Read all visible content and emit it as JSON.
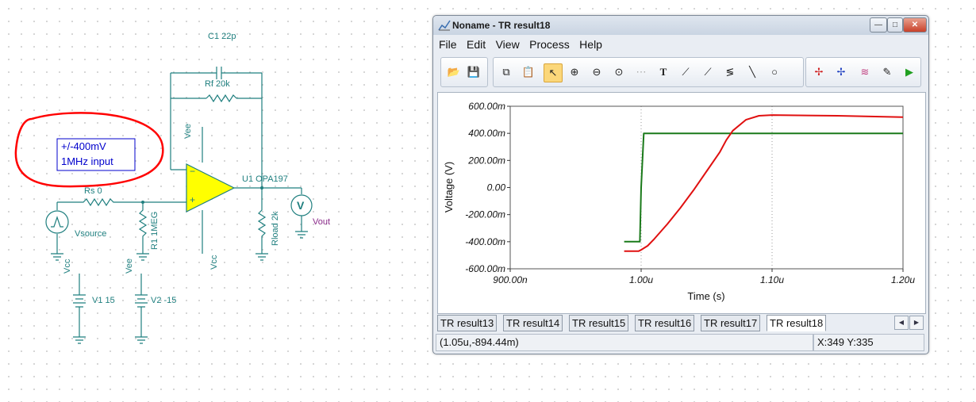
{
  "schematic": {
    "labels": {
      "c1": "C1 22p",
      "rf": "Rf 20k",
      "vee_opamp": "Vee",
      "u1": "U1 OPA197",
      "rs": "Rs 0",
      "r1": "R1 1MEG",
      "vsource": "Vsource",
      "vcc_opamp": "Vcc",
      "rload": "Rload 2k",
      "vout": "Vout",
      "vcc_supply": "Vcc",
      "vee_supply": "Vee",
      "v1": "V1 15",
      "v2": "V2 -15",
      "meter": "V"
    },
    "annotation": {
      "line1": "+/-400mV",
      "line2": "1MHz input"
    },
    "colors": {
      "wire": "#1f7f7f",
      "opamp_fill": "#ffff00",
      "annotation_circle": "#ff0000",
      "annotation_text": "#0000cc",
      "vout_label": "#8a2a8a"
    }
  },
  "window": {
    "title": "Noname - TR result18",
    "buttons": {
      "minimize": "—",
      "maximize": "□",
      "close": "✕"
    },
    "menu": [
      "File",
      "Edit",
      "View",
      "Process",
      "Help"
    ],
    "toolbar_icons": [
      "open-icon",
      "save-icon",
      "copy-icon",
      "paste-icon",
      "pointer-icon",
      "zoom-in-icon",
      "zoom-out-icon",
      "zoom-100-icon",
      "grid-icon",
      "text-icon",
      "cursor-a-icon",
      "cursor-b-icon",
      "cursor-diff-icon",
      "line-icon",
      "circle-icon",
      "marker-red-icon",
      "marker-blue-icon",
      "series-icon",
      "probe-icon",
      "run-icon"
    ],
    "tabs": [
      "TR result13",
      "TR result14",
      "TR result15",
      "TR result16",
      "TR result17",
      "TR result18"
    ],
    "active_tab": "TR result18",
    "status": {
      "cursor_value": "(1.05u,-894.44m)",
      "coords": "X:349  Y:335"
    }
  },
  "chart_data": {
    "type": "line",
    "xlabel": "Time (s)",
    "ylabel": "Voltage (V)",
    "xlim": [
      9e-07,
      1.2e-06
    ],
    "ylim": [
      -0.6,
      0.6
    ],
    "x_ticks": [
      "900.00n",
      "1.00u",
      "1.10u",
      "1.20u"
    ],
    "x_tick_values": [
      9e-07,
      1e-06,
      1.1e-06,
      1.2e-06
    ],
    "y_ticks": [
      "600.00m",
      "400.00m",
      "200.00m",
      "0.00",
      "-200.00m",
      "-400.00m",
      "-600.00m"
    ],
    "y_tick_values": [
      0.6,
      0.4,
      0.2,
      0.0,
      -0.2,
      -0.4,
      -0.6
    ],
    "grid": true,
    "series": [
      {
        "color": "#1a7a1a",
        "x": [
          9.87e-07,
          9.99e-07,
          1e-06,
          1.002e-06,
          1.2e-06
        ],
        "y": [
          -0.4,
          -0.4,
          0.0,
          0.4,
          0.4
        ]
      },
      {
        "color": "#e01010",
        "x": [
          9.87e-07,
          9.98e-07,
          1e-06,
          1.005e-06,
          1.01e-06,
          1.02e-06,
          1.03e-06,
          1.04e-06,
          1.05e-06,
          1.06e-06,
          1.065e-06,
          1.07e-06,
          1.08e-06,
          1.09e-06,
          1.1e-06,
          1.15e-06,
          1.2e-06
        ],
        "y": [
          -0.47,
          -0.47,
          -0.46,
          -0.43,
          -0.38,
          -0.27,
          -0.15,
          -0.02,
          0.12,
          0.26,
          0.35,
          0.42,
          0.5,
          0.53,
          0.535,
          0.53,
          0.52
        ]
      }
    ]
  }
}
